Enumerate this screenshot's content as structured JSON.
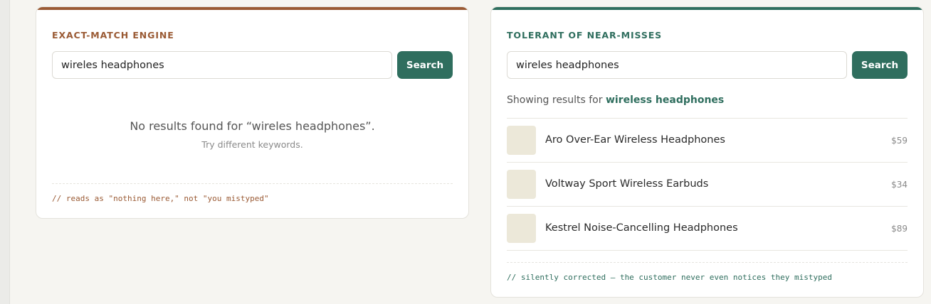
{
  "exact": {
    "heading": "EXACT-MATCH ENGINE",
    "search_value": "wireles headphones",
    "button_label": "Search",
    "empty_title": "No results found for “wireles headphones”.",
    "empty_subtitle": "Try different keywords.",
    "note": "// reads as \"nothing here,\" not \"you mistyped\"",
    "accent_color": "#9a5a34"
  },
  "tolerant": {
    "heading": "TOLERANT OF NEAR-MISSES",
    "search_value": "wireles headphones",
    "button_label": "Search",
    "showing_prefix": "Showing results for",
    "corrected_query": "wireless headphones",
    "results": [
      {
        "name": "Aro Over-Ear Wireless Headphones",
        "price": "$59"
      },
      {
        "name": "Voltway Sport Wireless Earbuds",
        "price": "$34"
      },
      {
        "name": "Kestrel Noise-Cancelling Headphones",
        "price": "$89"
      }
    ],
    "note": "// silently corrected — the customer never even notices they mistyped",
    "accent_color": "#2f6e5e"
  }
}
